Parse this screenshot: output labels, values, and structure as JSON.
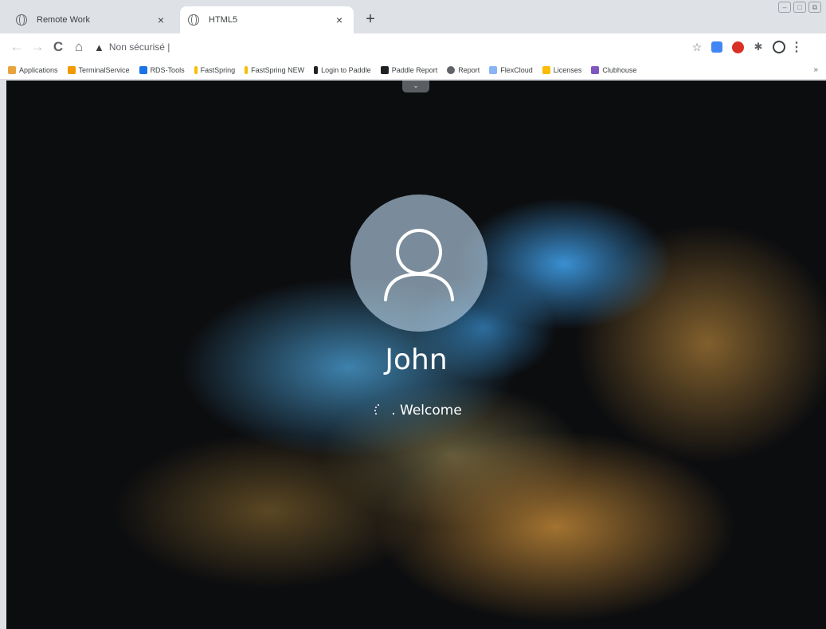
{
  "tabs": [
    {
      "title": "Remote Work",
      "icon": "globe-icon",
      "close": "×",
      "active": false
    },
    {
      "title": "HTML5",
      "icon": "globe-icon",
      "close": "×",
      "active": true
    }
  ],
  "new_tab_label": "+",
  "window_controls": [
    "–",
    "□",
    "⧉"
  ],
  "toolbar": {
    "back": "←",
    "forward": "→",
    "reload": "C",
    "home": "⌂",
    "security_icon": "▲",
    "address": "Non sécurisé |",
    "bookmark_star": "☆",
    "menu": "⋮"
  },
  "bookmarks": [
    {
      "label": "Applications",
      "color": "#e8a33d"
    },
    {
      "label": "TerminalService",
      "color": "#f29900"
    },
    {
      "label": "RDS-Tools",
      "color": "#1a73e8"
    },
    {
      "label": "FastSpring",
      "color": "#fbbc04"
    },
    {
      "label": "FastSpring NEW",
      "color": "#fbbc04"
    },
    {
      "label": "Login to Paddle",
      "color": "#202124"
    },
    {
      "label": "Paddle Report",
      "color": "#202124"
    },
    {
      "label": "Report",
      "color": "#5f6368"
    },
    {
      "label": "FlexCloud",
      "color": "#8ab4f8"
    },
    {
      "label": "Licenses",
      "color": "#fbbc04"
    },
    {
      "label": "Clubhouse",
      "color": "#7e57c2"
    }
  ],
  "bookmarks_more": "»",
  "remote": {
    "handle_icon": "⌄",
    "username": "John",
    "status_text": ". Welcome"
  }
}
